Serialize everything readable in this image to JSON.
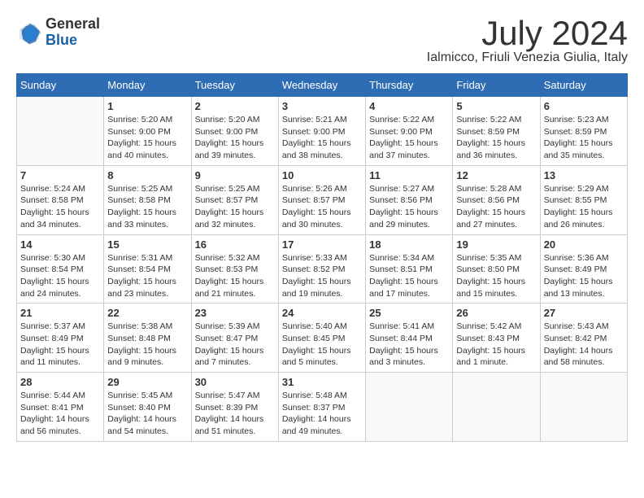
{
  "header": {
    "logo_general": "General",
    "logo_blue": "Blue",
    "month": "July 2024",
    "location": "Ialmicco, Friuli Venezia Giulia, Italy"
  },
  "days_of_week": [
    "Sunday",
    "Monday",
    "Tuesday",
    "Wednesday",
    "Thursday",
    "Friday",
    "Saturday"
  ],
  "weeks": [
    [
      {
        "day": "",
        "content": ""
      },
      {
        "day": "1",
        "content": "Sunrise: 5:20 AM\nSunset: 9:00 PM\nDaylight: 15 hours\nand 40 minutes."
      },
      {
        "day": "2",
        "content": "Sunrise: 5:20 AM\nSunset: 9:00 PM\nDaylight: 15 hours\nand 39 minutes."
      },
      {
        "day": "3",
        "content": "Sunrise: 5:21 AM\nSunset: 9:00 PM\nDaylight: 15 hours\nand 38 minutes."
      },
      {
        "day": "4",
        "content": "Sunrise: 5:22 AM\nSunset: 9:00 PM\nDaylight: 15 hours\nand 37 minutes."
      },
      {
        "day": "5",
        "content": "Sunrise: 5:22 AM\nSunset: 8:59 PM\nDaylight: 15 hours\nand 36 minutes."
      },
      {
        "day": "6",
        "content": "Sunrise: 5:23 AM\nSunset: 8:59 PM\nDaylight: 15 hours\nand 35 minutes."
      }
    ],
    [
      {
        "day": "7",
        "content": "Sunrise: 5:24 AM\nSunset: 8:58 PM\nDaylight: 15 hours\nand 34 minutes."
      },
      {
        "day": "8",
        "content": "Sunrise: 5:25 AM\nSunset: 8:58 PM\nDaylight: 15 hours\nand 33 minutes."
      },
      {
        "day": "9",
        "content": "Sunrise: 5:25 AM\nSunset: 8:57 PM\nDaylight: 15 hours\nand 32 minutes."
      },
      {
        "day": "10",
        "content": "Sunrise: 5:26 AM\nSunset: 8:57 PM\nDaylight: 15 hours\nand 30 minutes."
      },
      {
        "day": "11",
        "content": "Sunrise: 5:27 AM\nSunset: 8:56 PM\nDaylight: 15 hours\nand 29 minutes."
      },
      {
        "day": "12",
        "content": "Sunrise: 5:28 AM\nSunset: 8:56 PM\nDaylight: 15 hours\nand 27 minutes."
      },
      {
        "day": "13",
        "content": "Sunrise: 5:29 AM\nSunset: 8:55 PM\nDaylight: 15 hours\nand 26 minutes."
      }
    ],
    [
      {
        "day": "14",
        "content": "Sunrise: 5:30 AM\nSunset: 8:54 PM\nDaylight: 15 hours\nand 24 minutes."
      },
      {
        "day": "15",
        "content": "Sunrise: 5:31 AM\nSunset: 8:54 PM\nDaylight: 15 hours\nand 23 minutes."
      },
      {
        "day": "16",
        "content": "Sunrise: 5:32 AM\nSunset: 8:53 PM\nDaylight: 15 hours\nand 21 minutes."
      },
      {
        "day": "17",
        "content": "Sunrise: 5:33 AM\nSunset: 8:52 PM\nDaylight: 15 hours\nand 19 minutes."
      },
      {
        "day": "18",
        "content": "Sunrise: 5:34 AM\nSunset: 8:51 PM\nDaylight: 15 hours\nand 17 minutes."
      },
      {
        "day": "19",
        "content": "Sunrise: 5:35 AM\nSunset: 8:50 PM\nDaylight: 15 hours\nand 15 minutes."
      },
      {
        "day": "20",
        "content": "Sunrise: 5:36 AM\nSunset: 8:49 PM\nDaylight: 15 hours\nand 13 minutes."
      }
    ],
    [
      {
        "day": "21",
        "content": "Sunrise: 5:37 AM\nSunset: 8:49 PM\nDaylight: 15 hours\nand 11 minutes."
      },
      {
        "day": "22",
        "content": "Sunrise: 5:38 AM\nSunset: 8:48 PM\nDaylight: 15 hours\nand 9 minutes."
      },
      {
        "day": "23",
        "content": "Sunrise: 5:39 AM\nSunset: 8:47 PM\nDaylight: 15 hours\nand 7 minutes."
      },
      {
        "day": "24",
        "content": "Sunrise: 5:40 AM\nSunset: 8:45 PM\nDaylight: 15 hours\nand 5 minutes."
      },
      {
        "day": "25",
        "content": "Sunrise: 5:41 AM\nSunset: 8:44 PM\nDaylight: 15 hours\nand 3 minutes."
      },
      {
        "day": "26",
        "content": "Sunrise: 5:42 AM\nSunset: 8:43 PM\nDaylight: 15 hours\nand 1 minute."
      },
      {
        "day": "27",
        "content": "Sunrise: 5:43 AM\nSunset: 8:42 PM\nDaylight: 14 hours\nand 58 minutes."
      }
    ],
    [
      {
        "day": "28",
        "content": "Sunrise: 5:44 AM\nSunset: 8:41 PM\nDaylight: 14 hours\nand 56 minutes."
      },
      {
        "day": "29",
        "content": "Sunrise: 5:45 AM\nSunset: 8:40 PM\nDaylight: 14 hours\nand 54 minutes."
      },
      {
        "day": "30",
        "content": "Sunrise: 5:47 AM\nSunset: 8:39 PM\nDaylight: 14 hours\nand 51 minutes."
      },
      {
        "day": "31",
        "content": "Sunrise: 5:48 AM\nSunset: 8:37 PM\nDaylight: 14 hours\nand 49 minutes."
      },
      {
        "day": "",
        "content": ""
      },
      {
        "day": "",
        "content": ""
      },
      {
        "day": "",
        "content": ""
      }
    ]
  ]
}
